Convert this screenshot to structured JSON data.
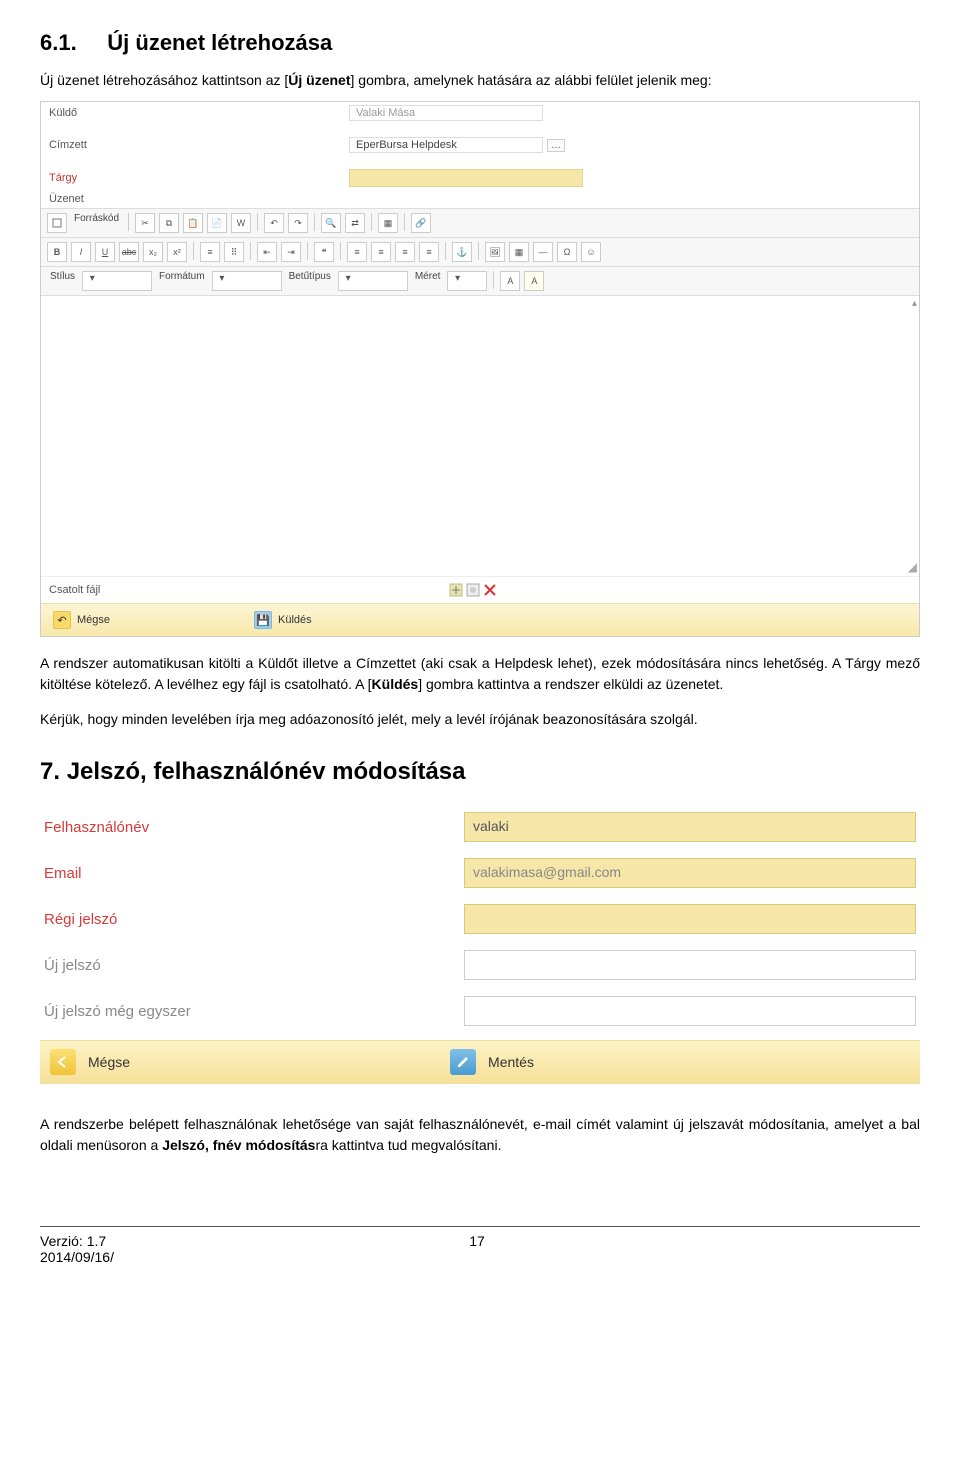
{
  "section1": {
    "number": "6.1.",
    "title": "Új üzenet létrehozása",
    "intro_1": "Új üzenet létrehozásához kattintson az [",
    "intro_bold": "Új üzenet",
    "intro_2": "] gombra, amelynek hatására az alábbi felület jelenik meg:"
  },
  "msgForm": {
    "sender_label": "Küldő",
    "sender_value": "Valaki Mása",
    "recipient_label": "Címzett",
    "recipient_value": "EperBursa Helpdesk",
    "subject_label": "Tárgy",
    "message_label": "Üzenet",
    "toolbar": {
      "source": "Forráskód",
      "style": "Stílus",
      "format": "Formátum",
      "font": "Betűtípus",
      "size": "Méret"
    },
    "attachment_label": "Csatolt fájl",
    "cancel": "Mégse",
    "send": "Küldés"
  },
  "para1": {
    "t1": "A rendszer automatikusan kitölti a Küldőt illetve a Címzettet (aki csak a Helpdesk lehet), ezek módosítására nincs lehetőség. A Tárgy mező kitöltése kötelező. A levélhez egy fájl is csatolható. A [",
    "bold1": "Küldés",
    "t2": "] gombra kattintva a rendszer elküldi az üzenetet."
  },
  "para2": "Kérjük, hogy minden levelében írja meg adóazonosító jelét, mely a levél írójának beazonosítására szolgál.",
  "section2": {
    "number": "7.",
    "title": "Jelszó, felhasználónév módosítása"
  },
  "cred": {
    "username_label": "Felhasználónév",
    "username_value": "valaki",
    "email_label": "Email",
    "email_value": "valakimasa@gmail.com",
    "oldpw_label": "Régi jelszó",
    "newpw_label": "Új jelszó",
    "newpw2_label": "Új jelszó még egyszer",
    "cancel": "Mégse",
    "save": "Mentés"
  },
  "para3": {
    "t1": "A rendszerbe belépett felhasználónak lehetősége van saját felhasználónevét, e-mail címét valamint új jelszavát módosítania, amelyet a bal oldali menüsoron a ",
    "bold": "Jelszó, fnév módosítás",
    "t2": "ra kattintva tud megvalósítani."
  },
  "footer": {
    "version": "Verzió: 1.7",
    "date": "2014/09/16/",
    "page": "17"
  }
}
